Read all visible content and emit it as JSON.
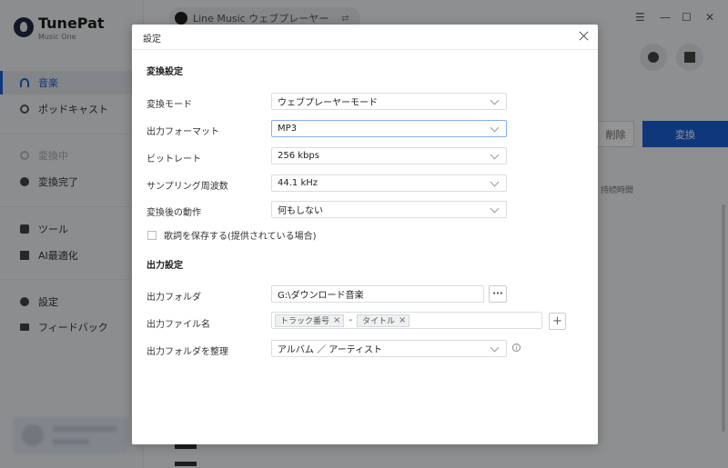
{
  "app": {
    "name": "TunePat",
    "subtitle": "Music One"
  },
  "sidebar": {
    "items": [
      {
        "label": "音楽",
        "icon": "headphones-icon"
      },
      {
        "label": "ポッドキャスト",
        "icon": "podcast-icon"
      },
      {
        "label": "変換中",
        "icon": "sync-icon"
      },
      {
        "label": "変換完了",
        "icon": "clock-icon"
      },
      {
        "label": "ツール",
        "icon": "toolbox-icon"
      },
      {
        "label": "AI最適化",
        "icon": "ai-icon"
      },
      {
        "label": "設定",
        "icon": "gear-icon"
      },
      {
        "label": "フィードバック",
        "icon": "mail-icon"
      }
    ]
  },
  "header": {
    "source": "Line Music ウェブプレーヤー",
    "swap_glyph": "⇄",
    "menu_glyph": "☰",
    "min_glyph": "—",
    "max_glyph": "☐",
    "close_glyph": "✕"
  },
  "main": {
    "delete_label": "削除",
    "convert_label": "変換",
    "duration_header": "持続時間"
  },
  "dialog": {
    "title": "設定",
    "conversion_section": "変換設定",
    "rows": [
      {
        "label": "変換モード",
        "value": "ウェブプレーヤーモード"
      },
      {
        "label": "出力フォーマット",
        "value": "MP3"
      },
      {
        "label": "ビットレート",
        "value": "256 kbps"
      },
      {
        "label": "サンプリング周波数",
        "value": "44.1 kHz"
      },
      {
        "label": "変換後の動作",
        "value": "何もしない"
      }
    ],
    "save_lyrics_label": "歌詞を保存する(提供されている場合)",
    "output_section": "出力設定",
    "output_folder_label": "出力フォルダ",
    "output_folder_value": "G:\\ダウンロード音楽",
    "browse_label": "···",
    "output_filename_label": "出力ファイル名",
    "filename_tags": [
      "トラック番号",
      "タイトル"
    ],
    "tag_separator": "-",
    "tag_remove": "×",
    "add_label": "+",
    "organize_label": "出力フォルダを整理",
    "organize_value": "アルバム ／ アーティスト",
    "info_glyph": "i"
  },
  "colors": {
    "accent": "#1a5fd6",
    "focus_border": "#7fb0f2"
  }
}
